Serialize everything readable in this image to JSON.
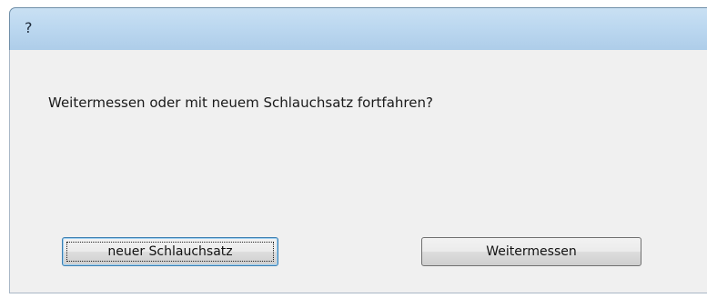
{
  "window": {
    "title": "?"
  },
  "dialog": {
    "message": "Weitermessen oder mit neuem Schlauchsatz fortfahren?"
  },
  "buttons": {
    "new_tubing_label": "neuer Schlauchsatz",
    "continue_label": "Weitermessen"
  }
}
